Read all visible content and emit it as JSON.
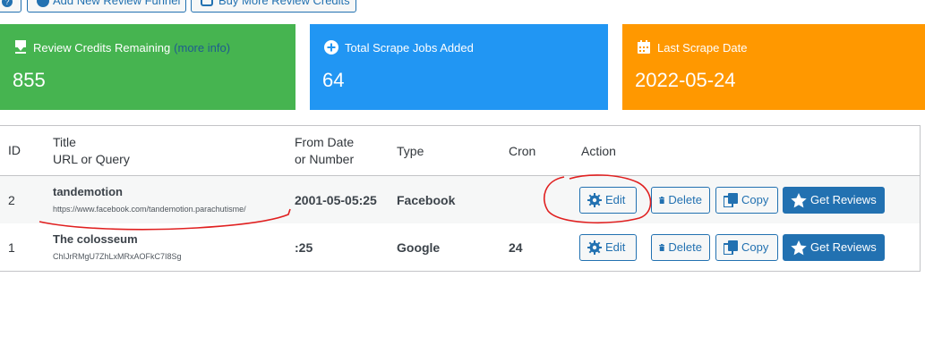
{
  "toolbar": {
    "help_icon": "question-circle-icon",
    "add_funnel_label": "Add New Review Funnel",
    "buy_credits_label": "Buy More Review Credits"
  },
  "cards": {
    "credits": {
      "title": "Review Credits Remaining",
      "link": "(more info)",
      "value": "855",
      "color": "#46b450",
      "icon": "download-icon"
    },
    "jobs": {
      "title": "Total Scrape Jobs Added",
      "value": "64",
      "color": "#2196f3",
      "icon": "plus-circle-icon"
    },
    "last": {
      "title": "Last Scrape Date",
      "value": "2022-05-24",
      "color": "#ff9800",
      "icon": "calendar-icon"
    }
  },
  "table": {
    "headers": {
      "id": "ID",
      "title1": "Title",
      "title2": "URL or Query",
      "from1": "From Date",
      "from2": "or Number",
      "type": "Type",
      "cron": "Cron",
      "action": "Action"
    },
    "rows": [
      {
        "id": "2",
        "title": "tandemotion",
        "url": "https://www.facebook.com/tandemotion.parachutisme/",
        "from": "2001-05-05:25",
        "type": "Facebook",
        "cron": ""
      },
      {
        "id": "1",
        "title": "The colosseum",
        "url": "ChIJrRMgU7ZhLxMRxAOFkC7I8Sg",
        "from": ":25",
        "type": "Google",
        "cron": "24"
      }
    ],
    "actions": {
      "edit": "Edit",
      "delete": "Delete",
      "copy": "Copy",
      "get": "Get Reviews"
    }
  }
}
